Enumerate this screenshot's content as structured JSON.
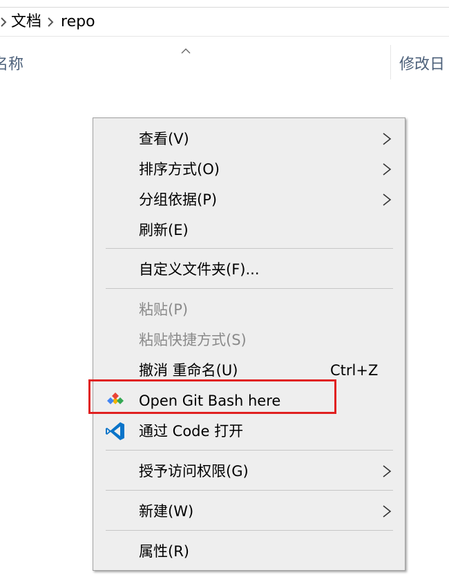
{
  "breadcrumb": {
    "items": [
      "文档",
      "repo"
    ]
  },
  "columns": {
    "name_label": "名称",
    "date_label": "修改日"
  },
  "menu": {
    "items": [
      {
        "label": "查看(V)",
        "submenu": true
      },
      {
        "label": "排序方式(O)",
        "submenu": true
      },
      {
        "label": "分组依据(P)",
        "submenu": true
      },
      {
        "label": "刷新(E)"
      },
      {
        "label": "自定义文件夹(F)..."
      },
      {
        "label": "粘贴(P)",
        "disabled": true
      },
      {
        "label": "粘贴快捷方式(S)",
        "disabled": true
      },
      {
        "label": "撤消 重命名(U)",
        "shortcut": "Ctrl+Z"
      },
      {
        "label": "Open Git Bash here",
        "icon": "git-bash-icon",
        "highlighted": true
      },
      {
        "label": "通过 Code 打开",
        "icon": "vscode-icon"
      },
      {
        "label": "授予访问权限(G)",
        "submenu": true
      },
      {
        "label": "新建(W)",
        "submenu": true
      },
      {
        "label": "属性(R)"
      }
    ]
  },
  "colors": {
    "menu_background": "#eeeeee",
    "highlight_border": "#e02020",
    "disabled_text": "#8a8a8a",
    "column_header_text": "#4c607a"
  }
}
